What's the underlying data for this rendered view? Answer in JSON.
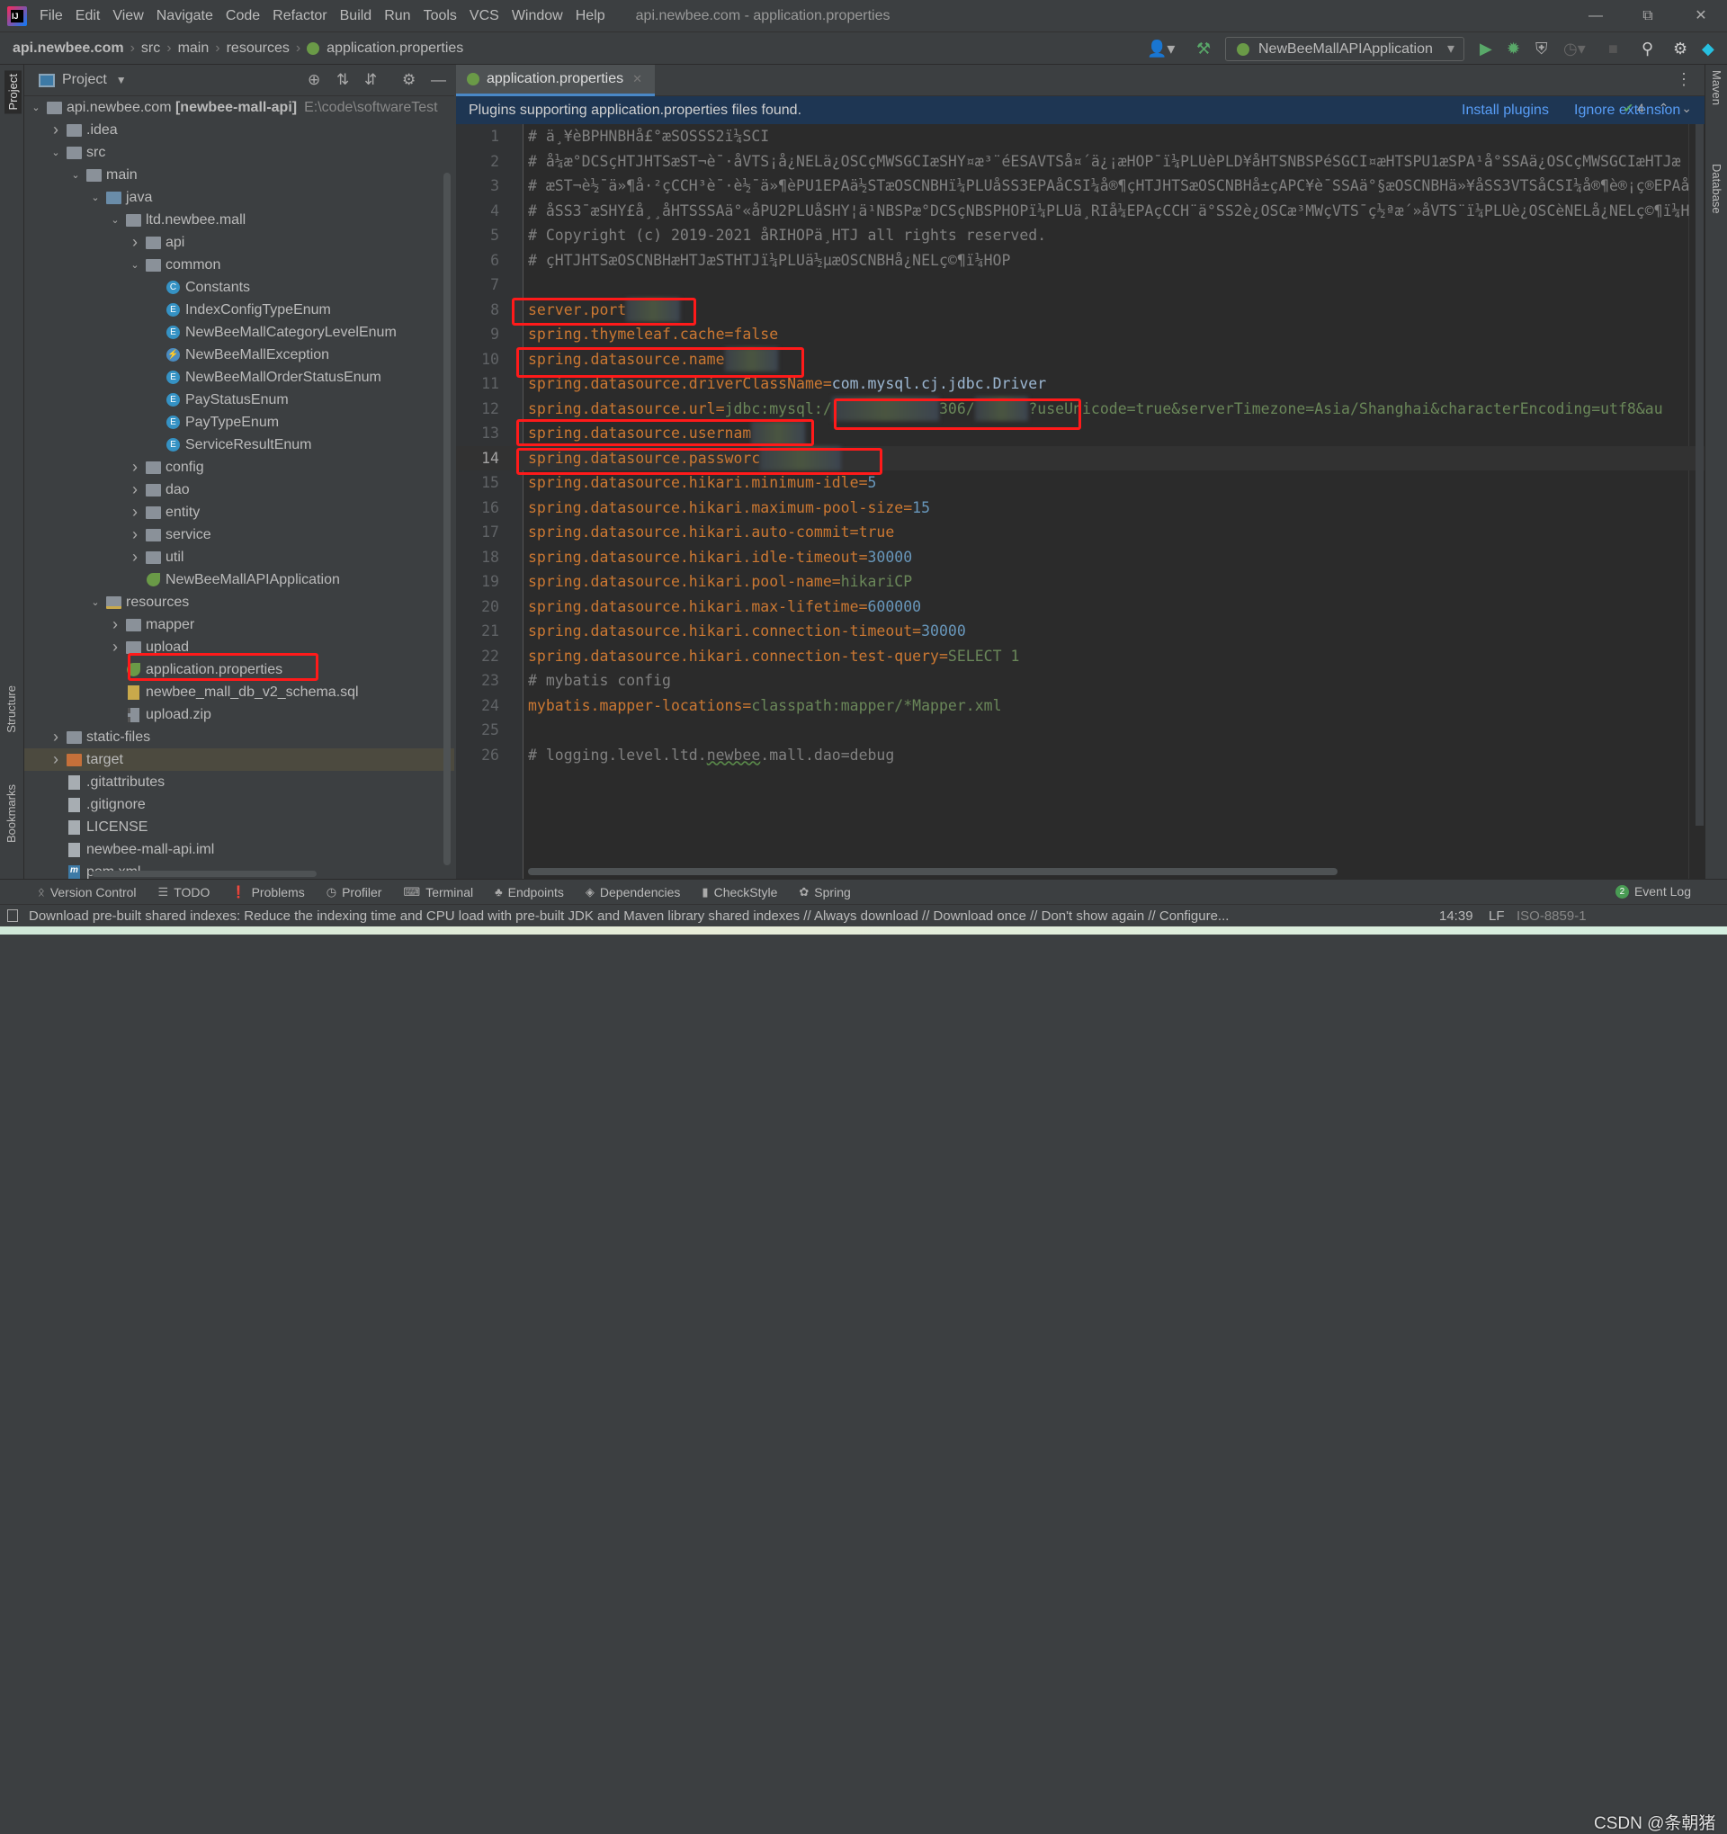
{
  "window": {
    "title": "api.newbee.com - application.properties",
    "menu": [
      "File",
      "Edit",
      "View",
      "Navigate",
      "Code",
      "Refactor",
      "Build",
      "Run",
      "Tools",
      "VCS",
      "Window",
      "Help"
    ]
  },
  "breadcrumbs": [
    "api.newbee.com",
    "src",
    "main",
    "resources",
    "application.properties"
  ],
  "toolbar": {
    "run_config": "NewBeeMallAPIApplication",
    "icons": [
      "user-icon",
      "build-hammer-icon",
      "run-icon",
      "debug-icon",
      "coverage-icon",
      "profile-icon",
      "stop-icon",
      "search-icon",
      "settings-gear-icon",
      "toolbox-icon"
    ]
  },
  "left_strip": {
    "project": "Project",
    "structure": "Structure",
    "bookmarks": "Bookmarks"
  },
  "right_strip": {
    "maven": "Maven",
    "database": "Database"
  },
  "project_panel": {
    "title": "Project",
    "tree": [
      {
        "level": 0,
        "arrow": "open",
        "icon": "module",
        "label": "api.newbee.com",
        "bold": "[newbee-mall-api]",
        "path": "E:\\code\\softwareTest"
      },
      {
        "level": 1,
        "arrow": "closed",
        "icon": "folder",
        "label": ".idea"
      },
      {
        "level": 1,
        "arrow": "open",
        "icon": "folder",
        "label": "src"
      },
      {
        "level": 2,
        "arrow": "open",
        "icon": "folder",
        "label": "main"
      },
      {
        "level": 3,
        "arrow": "open",
        "icon": "folder-blue",
        "label": "java"
      },
      {
        "level": 4,
        "arrow": "open",
        "icon": "package",
        "label": "ltd.newbee.mall"
      },
      {
        "level": 5,
        "arrow": "closed",
        "icon": "package",
        "label": "api"
      },
      {
        "level": 5,
        "arrow": "open",
        "icon": "package",
        "label": "common"
      },
      {
        "level": 6,
        "icon": "class",
        "label": "Constants"
      },
      {
        "level": 6,
        "icon": "enum",
        "label": "IndexConfigTypeEnum"
      },
      {
        "level": 6,
        "icon": "enum",
        "label": "NewBeeMallCategoryLevelEnum"
      },
      {
        "level": 6,
        "icon": "exception",
        "label": "NewBeeMallException"
      },
      {
        "level": 6,
        "icon": "enum",
        "label": "NewBeeMallOrderStatusEnum"
      },
      {
        "level": 6,
        "icon": "enum",
        "label": "PayStatusEnum"
      },
      {
        "level": 6,
        "icon": "enum",
        "label": "PayTypeEnum"
      },
      {
        "level": 6,
        "icon": "enum",
        "label": "ServiceResultEnum"
      },
      {
        "level": 5,
        "arrow": "closed",
        "icon": "package",
        "label": "config"
      },
      {
        "level": 5,
        "arrow": "closed",
        "icon": "package",
        "label": "dao"
      },
      {
        "level": 5,
        "arrow": "closed",
        "icon": "package",
        "label": "entity"
      },
      {
        "level": 5,
        "arrow": "closed",
        "icon": "package",
        "label": "service"
      },
      {
        "level": 5,
        "arrow": "closed",
        "icon": "package",
        "label": "util"
      },
      {
        "level": 5,
        "icon": "spring-app",
        "label": "NewBeeMallAPIApplication"
      },
      {
        "level": 3,
        "arrow": "open",
        "icon": "folder-res",
        "label": "resources"
      },
      {
        "level": 4,
        "arrow": "closed",
        "icon": "folder",
        "label": "mapper"
      },
      {
        "level": 4,
        "arrow": "closed",
        "icon": "folder",
        "label": "upload"
      },
      {
        "level": 4,
        "icon": "properties",
        "label": "application.properties",
        "highlighted": true
      },
      {
        "level": 4,
        "icon": "sql",
        "label": "newbee_mall_db_v2_schema.sql"
      },
      {
        "level": 4,
        "icon": "zip",
        "label": "upload.zip"
      },
      {
        "level": 1,
        "arrow": "closed",
        "icon": "folder",
        "label": "static-files"
      },
      {
        "level": 1,
        "arrow": "closed",
        "icon": "folder-orange",
        "label": "target",
        "selected": true
      },
      {
        "level": 1,
        "icon": "file",
        "label": ".gitattributes"
      },
      {
        "level": 1,
        "icon": "file",
        "label": ".gitignore"
      },
      {
        "level": 1,
        "icon": "file",
        "label": "LICENSE"
      },
      {
        "level": 1,
        "icon": "file",
        "label": "newbee-mall-api.iml"
      },
      {
        "level": 1,
        "icon": "maven",
        "label": "pom.xml"
      }
    ]
  },
  "editor": {
    "tab": "application.properties",
    "banner": {
      "text": "Plugins supporting application.properties files found.",
      "install": "Install plugins",
      "ignore": "Ignore extension"
    },
    "inspection_count": "4",
    "current_line": 14,
    "lines": [
      [
        {
          "t": "# ä¸¥èBPHNBHå£°æSOSSS2ï¼SCI",
          "c": "c"
        }
      ],
      [
        {
          "t": "# å¼æ°DCSçHTJHTSæST¬è¯·åVTS¡å¿NELä¿OSCçMWSGCIæSHY¤æ³¨éESAVTSå¤´ä¿¡æHOP¯ï¼PLUèPLD¥åHTSNBSPéSGCI¤æHTSPU1æSPA¹å°SSAä¿OSCçMWSGCIæHTJæ",
          "c": "c"
        }
      ],
      [
        {
          "t": "# æST¬è½¯ä»¶å·²çCCH³è¯·è½¯ä»¶èPU1EPAä½STæOSCNBHï¼PLUåSS3EPAåCSI¼å®¶çHTJHTSæOSCNBHå±çAPC¥è¯SSAä°§æOSCNBHä»¥åSS3VTSåCSI¼å®¶è®¡ç®EPAå",
          "c": "c"
        }
      ],
      [
        {
          "t": "# åSS3¯æSHY£å¸¸åHTSSSAä°«åPU2PLUåSHY¦ä¹NBSPæ°DCSçNBSPHOPï¼PLUä¸RIå¼EPAçCCH¨ä°SS2è¿OSCæ³MWçVTS¯ç½ªæ´»åVTS¨ï¼PLUè¿OSCèNELå¿NELç©¶ï¼H",
          "c": "c"
        }
      ],
      [
        {
          "t": "# Copyright (c) 2019-2021 åRIHOPä¸HTJ all rights reserved.",
          "c": "c"
        }
      ],
      [
        {
          "t": "# çHTJHTSæOSCNBHæHTJæSTHTJï¼PLUä½µæOSCNBHå¿NELç©¶ï¼HOP",
          "c": "c"
        }
      ],
      [],
      [
        {
          "t": "server.port",
          "c": "k"
        },
        {
          "t": "      ",
          "c": "blur"
        }
      ],
      [
        {
          "t": "spring.thymeleaf.cache=false",
          "c": "k"
        }
      ],
      [
        {
          "t": "spring.datasource.name",
          "c": "k"
        },
        {
          "t": "      ",
          "c": "blur"
        }
      ],
      [
        {
          "t": "spring.datasource.driverClassName",
          "c": "k"
        },
        {
          "t": "=",
          "c": "o"
        },
        {
          "t": "com.mysql.cj.jdbc.Driver",
          "c": "d"
        }
      ],
      [
        {
          "t": "spring.datasource.url",
          "c": "k"
        },
        {
          "t": "=",
          "c": "o"
        },
        {
          "t": "jdbc:mysql:/",
          "c": "v"
        },
        {
          "t": "            ",
          "c": "blur"
        },
        {
          "t": "306/",
          "c": "v"
        },
        {
          "t": "      ",
          "c": "blur"
        },
        {
          "t": "?useUnicode=true&serverTimezone=Asia/Shanghai&characterEncoding=utf8&au",
          "c": "v"
        }
      ],
      [
        {
          "t": "spring.datasource.usernam",
          "c": "k"
        },
        {
          "t": "      ",
          "c": "blur"
        }
      ],
      [
        {
          "t": "spring.datasource.passworc",
          "c": "k"
        },
        {
          "t": "         ",
          "c": "blur"
        }
      ],
      [
        {
          "t": "spring.datasource.hikari.minimum-idle",
          "c": "k"
        },
        {
          "t": "=",
          "c": "o"
        },
        {
          "t": "5",
          "c": "n"
        }
      ],
      [
        {
          "t": "spring.datasource.hikari.maximum-pool-size",
          "c": "k"
        },
        {
          "t": "=",
          "c": "o"
        },
        {
          "t": "15",
          "c": "n"
        }
      ],
      [
        {
          "t": "spring.datasource.hikari.auto-commit",
          "c": "k"
        },
        {
          "t": "=",
          "c": "o"
        },
        {
          "t": "true",
          "c": "k"
        }
      ],
      [
        {
          "t": "spring.datasource.hikari.idle-timeout",
          "c": "k"
        },
        {
          "t": "=",
          "c": "o"
        },
        {
          "t": "30000",
          "c": "n"
        }
      ],
      [
        {
          "t": "spring.datasource.hikari.pool-name",
          "c": "k"
        },
        {
          "t": "=",
          "c": "o"
        },
        {
          "t": "hikariCP",
          "c": "v"
        }
      ],
      [
        {
          "t": "spring.datasource.hikari.max-lifetime",
          "c": "k"
        },
        {
          "t": "=",
          "c": "o"
        },
        {
          "t": "600000",
          "c": "n"
        }
      ],
      [
        {
          "t": "spring.datasource.hikari.connection-timeout",
          "c": "k"
        },
        {
          "t": "=",
          "c": "o"
        },
        {
          "t": "30000",
          "c": "n"
        }
      ],
      [
        {
          "t": "spring.datasource.hikari.connection-test-query",
          "c": "k"
        },
        {
          "t": "=",
          "c": "o"
        },
        {
          "t": "SELECT 1",
          "c": "v"
        }
      ],
      [
        {
          "t": "# mybatis config",
          "c": "c"
        }
      ],
      [
        {
          "t": "mybatis.mapper-locations",
          "c": "k"
        },
        {
          "t": "=",
          "c": "o"
        },
        {
          "t": "classpath:mapper/*Mapper.xml",
          "c": "v"
        }
      ],
      [],
      [
        {
          "t": "# logging.level.ltd.",
          "c": "c"
        },
        {
          "t": "newbee",
          "c": "c ul"
        },
        {
          "t": ".mall.dao=debug",
          "c": "c"
        }
      ]
    ]
  },
  "bottom_tools": [
    "Version Control",
    "TODO",
    "Problems",
    "Profiler",
    "Terminal",
    "Endpoints",
    "Dependencies",
    "CheckStyle",
    "Spring"
  ],
  "event_log": {
    "label": "Event Log",
    "count": "2"
  },
  "status": {
    "message": "Download pre-built shared indexes: Reduce the indexing time and CPU load with pre-built JDK and Maven library shared indexes // Always download // Download once // Don't show again // Configure...",
    "position": "14:39",
    "line_sep": "LF",
    "encoding": "ISO-8859-1"
  },
  "watermark": "CSDN @条朝猪"
}
